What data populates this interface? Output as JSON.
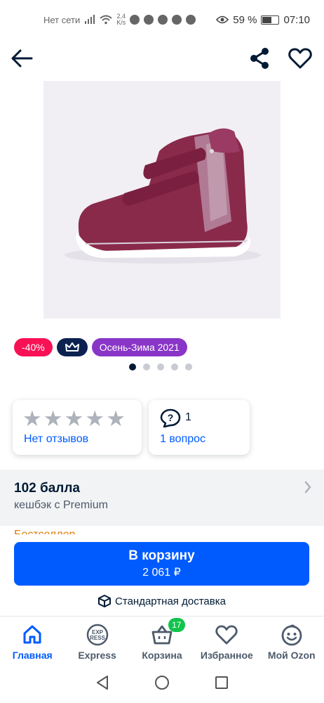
{
  "status_bar": {
    "network": "Нет сети",
    "speed_value": "2,4",
    "speed_unit": "K/s",
    "battery": "59 %",
    "battery_level": 0.59,
    "time": "07:10"
  },
  "badges": {
    "discount": "-40%",
    "season": "Осень-Зима 2021"
  },
  "carousel": {
    "count": 5,
    "active": 0
  },
  "rating_card": {
    "stars": 5,
    "link": "Нет отзывов"
  },
  "questions_card": {
    "count": "1",
    "link": "1 вопрос"
  },
  "cashback": {
    "title": "102 балла",
    "subtitle": "кешбэк с Premium"
  },
  "bestseller": "Бестселлер",
  "buy": {
    "label": "В корзину",
    "price": "2 061 ₽"
  },
  "delivery": "Стандартная доставка",
  "nav": {
    "home": "Главная",
    "express": "Express",
    "express_logo_top": "EXP",
    "express_logo_bottom": "RESS",
    "cart": "Корзина",
    "cart_count": "17",
    "favorites": "Избранное",
    "profile": "Мой Ozon"
  },
  "colors": {
    "accent": "#005bff",
    "discount": "#f91155",
    "premium": "#0b2251",
    "season": "#8935c7",
    "badge_green": "#10c44c"
  }
}
